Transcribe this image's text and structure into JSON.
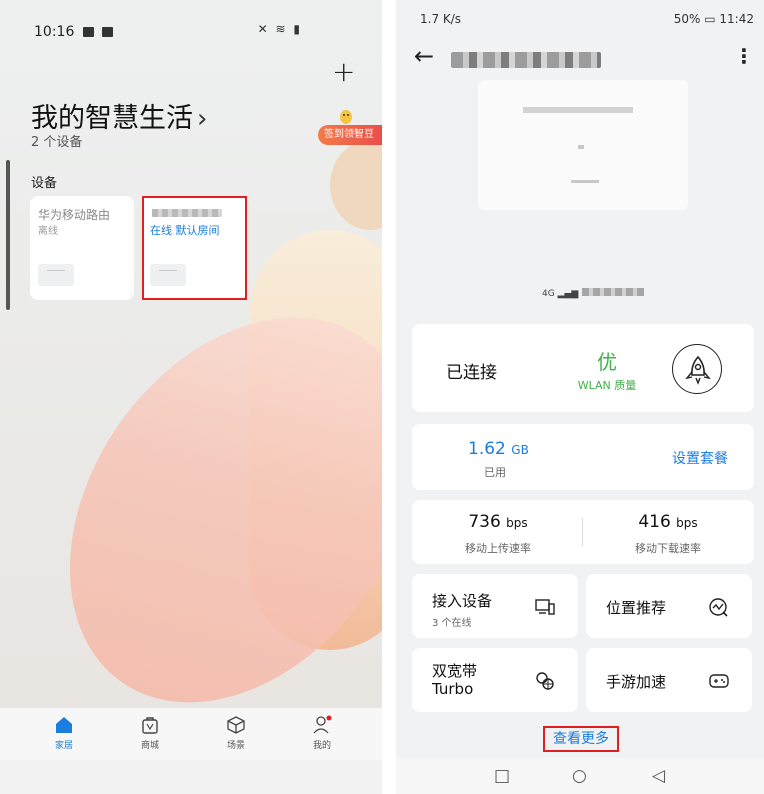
{
  "left": {
    "status_time": "10:16",
    "add_symbol": "+",
    "title": "我的智慧生活",
    "title_chevron": "›",
    "device_count": "2 个设备",
    "signin_badge": "签到领智豆",
    "section_label": "设备",
    "devices": [
      {
        "name": "华为移动路由",
        "status": "离线"
      },
      {
        "name": "",
        "status": "在线 默认房间"
      }
    ],
    "tabs": [
      {
        "label": "家居",
        "icon": "home-icon",
        "active": true
      },
      {
        "label": "商城",
        "icon": "store-bag-icon",
        "active": false
      },
      {
        "label": "场景",
        "icon": "cube-icon",
        "active": false
      },
      {
        "label": "我的",
        "icon": "person-icon",
        "active": false
      }
    ]
  },
  "right": {
    "status_left": "1.7 K/s",
    "status_right": "50% ▭ 11:42",
    "back_symbol": "←",
    "more_symbol": "⋮",
    "network_label": "4G",
    "connection": {
      "label": "已连接",
      "quality": "优",
      "quality_sub": "WLAN 质量"
    },
    "data_usage": {
      "value": "1.62",
      "unit": "GB",
      "label": "已用",
      "link": "设置套餐"
    },
    "speeds": [
      {
        "value": "736",
        "unit": "bps",
        "label": "移动上传速率"
      },
      {
        "value": "416",
        "unit": "bps",
        "label": "移动下载速率"
      }
    ],
    "tiles": [
      {
        "title": "接入设备",
        "sub": "3 个在线",
        "icon": "devices-icon"
      },
      {
        "title": "位置推荐",
        "sub": "",
        "icon": "signal-check-icon"
      },
      {
        "title": "双宽带",
        "title2": "Turbo",
        "sub": "",
        "icon": "dual-band-icon"
      },
      {
        "title": "手游加速",
        "sub": "",
        "icon": "gamepad-icon"
      }
    ],
    "see_more": "查看更多",
    "nav": [
      "□",
      "○",
      "◁"
    ]
  },
  "colors": {
    "accent": "#1a7de0",
    "good": "#3fb24b",
    "highlight": "#e02020"
  }
}
